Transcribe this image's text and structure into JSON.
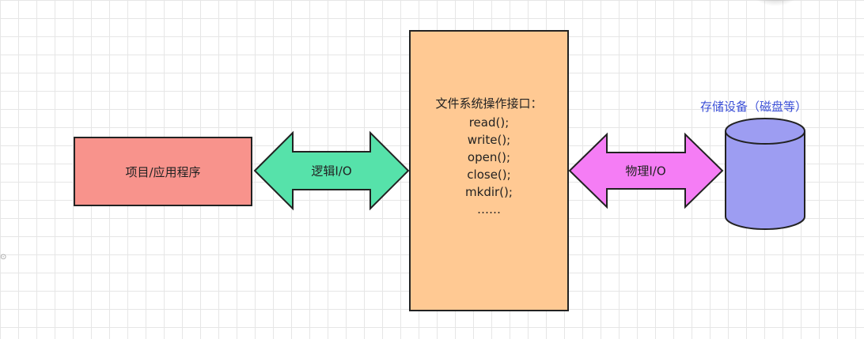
{
  "nodes": {
    "app": {
      "label": "项目/应用程序",
      "color": "#f8938c"
    },
    "filesystem": {
      "title": "文件系统操作接口：",
      "methods": [
        "read();",
        "write();",
        "open();",
        "close();",
        "mkdir();",
        "……"
      ],
      "color": "#ffc993"
    },
    "storage": {
      "label": "存储设备（磁盘等）",
      "color": "#9d9df2",
      "label_color": "#3b4fd6"
    }
  },
  "edges": {
    "logical": {
      "label": "逻辑I/O",
      "color": "#56e2aa"
    },
    "physical": {
      "label": "物理I/O",
      "color": "#f57df5"
    }
  },
  "colors": {
    "grid": "#e6e6e6",
    "stroke": "#222222"
  }
}
